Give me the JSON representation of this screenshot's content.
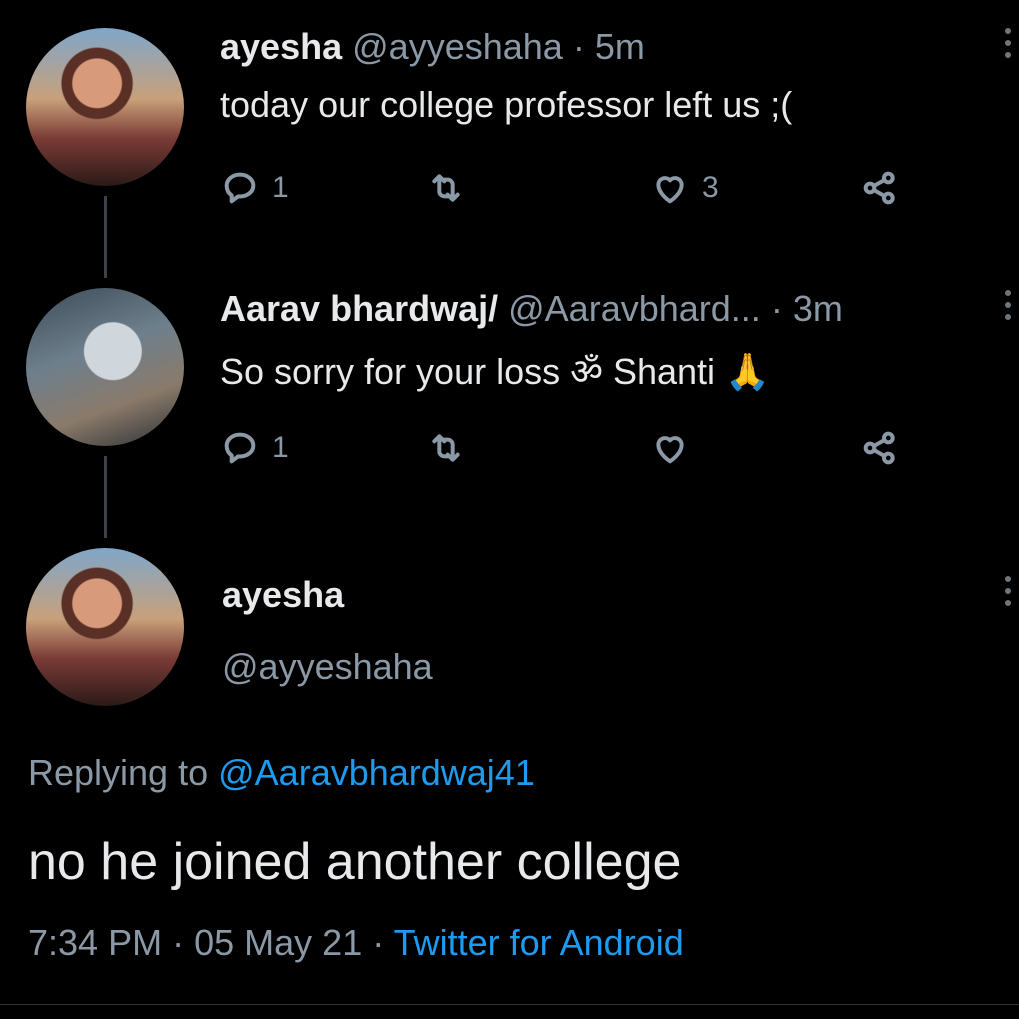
{
  "tweet1": {
    "name": "ayesha",
    "handle": "@ayyeshaha",
    "sep": "·",
    "time": "5m",
    "text": "today our college professor left us ;(",
    "reply_count": "1",
    "like_count": "3"
  },
  "tweet2": {
    "name": "Aarav bhardwaj/",
    "handle": "@Aaravbhard...",
    "sep": "·",
    "time": "3m",
    "text": "So sorry for your loss ॐ Shanti 🙏",
    "reply_count": "1"
  },
  "main": {
    "name": "ayesha",
    "handle": "@ayyeshaha",
    "replying_prefix": "Replying to",
    "replying_to": "@Aaravbhardwaj41",
    "text": "no he joined another college",
    "time": "7:34 PM",
    "sep1": "·",
    "date": "05 May 21",
    "sep2": "·",
    "source": "Twitter for Android"
  },
  "icons": {
    "reply": "comment-icon",
    "retweet": "retweet-icon",
    "like": "heart-icon",
    "share": "share-icon",
    "more": "more-vertical-icon"
  },
  "colors": {
    "background": "#000000",
    "text": "#e7e9ea",
    "muted": "#8b98a5",
    "link": "#1d9bf0"
  }
}
